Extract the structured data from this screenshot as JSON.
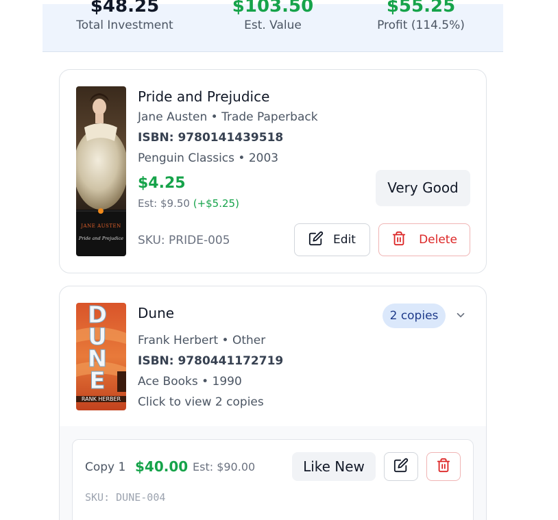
{
  "summary": {
    "total_investment": {
      "value": "$48.25",
      "label": "Total Investment"
    },
    "est_value": {
      "value": "$103.50",
      "label": "Est. Value"
    },
    "profit": {
      "value": "$55.25",
      "label": "Profit (114.5%)"
    }
  },
  "books": [
    {
      "title": "Pride and Prejudice",
      "author_format": "Jane Austen • Trade Paperback",
      "isbn": "ISBN: 9780141439518",
      "publisher_year": "Penguin Classics • 2003",
      "price": "$4.25",
      "est": "Est: $9.50",
      "gain": "(+$5.25)",
      "condition": "Very Good",
      "sku": "SKU: PRIDE-005",
      "edit_label": "Edit",
      "delete_label": "Delete",
      "cover_text": {
        "author": "JANE AUSTEN",
        "title": "Pride and Prejudice"
      }
    },
    {
      "title": "Dune",
      "author_format": "Frank Herbert • Other",
      "isbn": "ISBN: 9780441172719",
      "publisher_year": "Ace Books • 1990",
      "hint": "Click to view 2 copies",
      "copies_badge": "2 copies",
      "cover_text": {
        "title": "DUNE",
        "author": "RANK HERBER"
      },
      "copies": [
        {
          "label": "Copy 1",
          "price": "$40.00",
          "est": "Est: $90.00",
          "condition": "Like New",
          "sku": "SKU: DUNE-004"
        }
      ]
    }
  ],
  "icons": {
    "edit": "pencil-square-icon",
    "delete": "trash-icon",
    "expand": "chevron-down-icon"
  },
  "colors": {
    "accent_green": "#16a34a",
    "danger_red": "#dc2626",
    "badge_blue_bg": "#dbe8fb",
    "summary_bg": "#eef4fd"
  }
}
